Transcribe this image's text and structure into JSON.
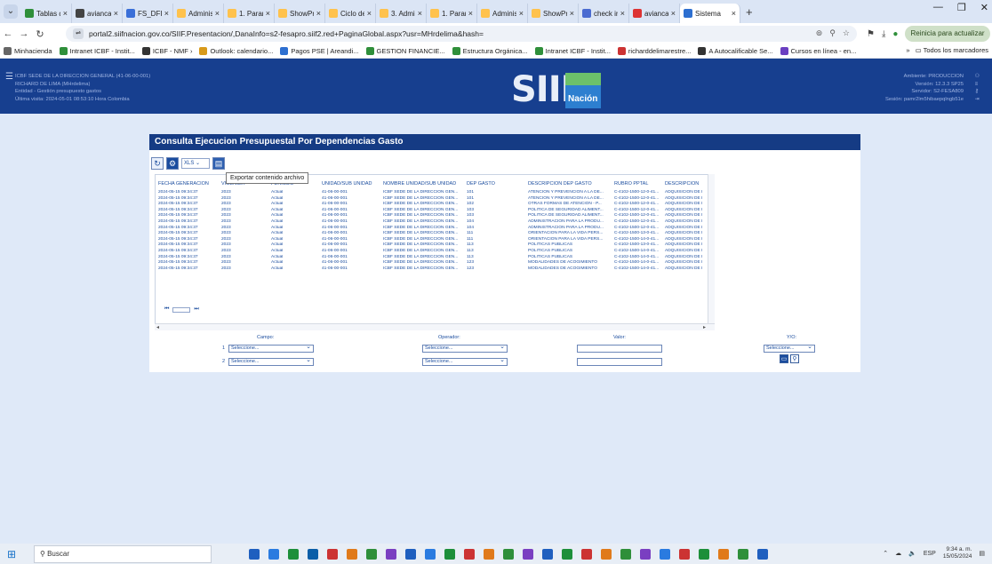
{
  "browser": {
    "tabs": [
      {
        "label": "Tablas de",
        "color": "#2f8f3a"
      },
      {
        "label": "avianca",
        "color": "#444"
      },
      {
        "label": "FS_DFIN",
        "color": "#3a6fd8"
      },
      {
        "label": "Administ",
        "color": "#ffc24d"
      },
      {
        "label": "1. Param",
        "color": "#ffc24d"
      },
      {
        "label": "ShowPro",
        "color": "#ffc24d"
      },
      {
        "label": "Ciclo de",
        "color": "#ffc24d"
      },
      {
        "label": "3. Admin",
        "color": "#ffc24d"
      },
      {
        "label": "1. Param",
        "color": "#ffc24d"
      },
      {
        "label": "Administ",
        "color": "#ffc24d"
      },
      {
        "label": "ShowPro",
        "color": "#ffc24d"
      },
      {
        "label": "check in",
        "color": "#4a6bd1"
      },
      {
        "label": "avianca",
        "color": "#d33"
      }
    ],
    "active_tab": {
      "label": "Sistema",
      "color": "#2d6fd0"
    },
    "url": "portal2.siifnacion.gov.co/SIIF.Presentacion/,DanaInfo=s2-fesapro.siif2.red+PaginaGlobal.aspx?usr=MHrdelima&hash=",
    "update_label": "Reinicia para actualizar",
    "bookmarks": [
      {
        "label": "Minhacienda",
        "color": "#666"
      },
      {
        "label": "Intranet ICBF - Instit...",
        "color": "#2f8f3a"
      },
      {
        "label": "ICBF - NMF ›",
        "color": "#333"
      },
      {
        "label": "Outlook: calendario...",
        "color": "#d89a1a"
      },
      {
        "label": "Pagos PSE | Areandi...",
        "color": "#2d6fd0"
      },
      {
        "label": "GESTION FINANCIE...",
        "color": "#2f8f3a"
      },
      {
        "label": "Estructura Orgánica...",
        "color": "#2f8f3a"
      },
      {
        "label": "Intranet ICBF - Instit...",
        "color": "#2f8f3a"
      },
      {
        "label": "richarddelimarestre...",
        "color": "#c33"
      },
      {
        "label": "A Autocalificable Se...",
        "color": "#333"
      },
      {
        "label": "Cursos en línea - en...",
        "color": "#6a3fc1"
      }
    ],
    "bookmarks_all": "Todos los marcadores"
  },
  "header": {
    "lines_left": [
      "ICBF SEDE DE LA DIRECCION GENERAL (41-06-00-001)",
      "RICHARD DE LIMA (MHrdelima)",
      "Entidad - Gestión presupuesto gastos",
      "Última visita: 2024-05-01 08:53:10 Hora Colombia"
    ],
    "logo_text": "SIIF",
    "logo_sub": "Nación",
    "lines_right": [
      "Ambiente: PRODUCCION",
      "Versión: 12.3.3 SP25",
      "Servidor: S2-FESA809",
      "Sesión: pamr2lm5hibaepqlngb51e"
    ]
  },
  "panel": {
    "title": "Consulta Ejecucion Presupuestal Por Dependencias Gasto",
    "format": "XLS",
    "tooltip": "Exportar contenido archivo",
    "columns": [
      "FECHA GENERACION",
      "VIGENCIA",
      "PERIODO",
      "UNIDAD/SUB UNIDAD",
      "NOMBRE UNIDAD/SUB UNIDAD",
      "DEP GASTO",
      "DESCRIPCION DEP GASTO",
      "RUBRO PPTAL",
      "DESCRIPCION"
    ],
    "rows": [
      [
        "2024-05-15 09:34:37",
        "2023",
        "Actual",
        "41-06-00-001",
        "ICBF SEDE DE LA DIRECCION GEN...",
        "101",
        "ATENCION Y PREVENCION A LA DE...",
        "C-4102-1500-12-0-41...",
        "ADQUISICIÓN DE I"
      ],
      [
        "2024-05-15 09:34:37",
        "2023",
        "Actual",
        "41-06-00-001",
        "ICBF SEDE DE LA DIRECCION GEN...",
        "101",
        "ATENCION Y PREVENCION A LA DE...",
        "C-4102-1500-12-0-41...",
        "ADQUISICIÓN DE I"
      ],
      [
        "2024-05-15 09:34:37",
        "2023",
        "Actual",
        "41-06-00-001",
        "ICBF SEDE DE LA DIRECCION GEN...",
        "102",
        "OTRAS FORMAS DE ATENCION - P...",
        "C-4102-1500-12-0-41...",
        "ADQUISICIÓN DE I"
      ],
      [
        "2024-05-15 09:34:37",
        "2023",
        "Actual",
        "41-06-00-001",
        "ICBF SEDE DE LA DIRECCION GEN...",
        "103",
        "POLITICA DE SEGURIDAD ALIMENT...",
        "C-4102-1500-12-0-41...",
        "ADQUISICIÓN DE I"
      ],
      [
        "2024-05-15 09:34:37",
        "2023",
        "Actual",
        "41-06-00-001",
        "ICBF SEDE DE LA DIRECCION GEN...",
        "103",
        "POLITICA DE SEGURIDAD ALIMENT...",
        "C-4102-1500-12-0-41...",
        "ADQUISICIÓN DE I"
      ],
      [
        "2024-05-15 09:34:37",
        "2023",
        "Actual",
        "41-06-00-001",
        "ICBF SEDE DE LA DIRECCION GEN...",
        "104",
        "ADMINISTRACION PARA LA PRODU...",
        "C-4102-1500-12-0-41...",
        "ADQUISICIÓN DE I"
      ],
      [
        "2024-05-15 09:34:37",
        "2023",
        "Actual",
        "41-06-00-001",
        "ICBF SEDE DE LA DIRECCION GEN...",
        "104",
        "ADMINISTRACION PARA LA PRODU...",
        "C-4102-1500-12-0-41...",
        "ADQUISICIÓN DE I"
      ],
      [
        "2024-05-15 09:34:37",
        "2023",
        "Actual",
        "41-06-00-001",
        "ICBF SEDE DE LA DIRECCION GEN...",
        "111",
        "ORIENTACION PARA LA VIDA PERS...",
        "C-4102-1500-13-0-41...",
        "ADQUISICIÓN DE I"
      ],
      [
        "2024-05-15 09:34:37",
        "2023",
        "Actual",
        "41-06-00-001",
        "ICBF SEDE DE LA DIRECCION GEN...",
        "111",
        "ORIENTACION PARA LA VIDA PERS...",
        "C-4102-1500-14-0-41...",
        "ADQUISICIÓN DE I"
      ],
      [
        "2024-05-15 09:34:37",
        "2023",
        "Actual",
        "41-06-00-001",
        "ICBF SEDE DE LA DIRECCION GEN...",
        "113",
        "POLITICAS PUBLICAS",
        "C-4102-1500-13-0-41...",
        "ADQUISICIÓN DE I"
      ],
      [
        "2024-05-15 09:34:37",
        "2023",
        "Actual",
        "41-06-00-001",
        "ICBF SEDE DE LA DIRECCION GEN...",
        "113",
        "POLITICAS PUBLICAS",
        "C-4102-1500-14-0-41...",
        "ADQUISICIÓN DE I"
      ],
      [
        "2024-05-15 09:34:37",
        "2023",
        "Actual",
        "41-06-00-001",
        "ICBF SEDE DE LA DIRECCION GEN...",
        "113",
        "POLITICAS PUBLICAS",
        "C-4102-1500-14-0-41...",
        "ADQUISICIÓN DE I"
      ],
      [
        "2024-05-15 09:34:37",
        "2023",
        "Actual",
        "41-06-00-001",
        "ICBF SEDE DE LA DIRECCION GEN...",
        "123",
        "MODALIDADES DE ACOGIMIENTO",
        "C-4102-1500-14-0-41...",
        "ADQUISICIÓN DE I"
      ],
      [
        "2024-05-15 09:34:37",
        "2023",
        "Actual",
        "41-06-00-001",
        "ICBF SEDE DE LA DIRECCION GEN...",
        "123",
        "MODALIDADES DE ACOGIMIENTO",
        "C-4102-1500-14-0-41...",
        "ADQUISICIÓN DE I"
      ]
    ],
    "filters": {
      "campo_label": "Campo:",
      "operador_label": "Operador:",
      "valor_label": "Valor:",
      "yo_label": "Y/O:",
      "row1_num": "1",
      "row2_num": "2",
      "select_text": "Seleccione..."
    }
  },
  "taskbar": {
    "search_placeholder": "Buscar",
    "lang": "ESP",
    "time": "9:34 a. m.",
    "date": "15/05/2024",
    "icons": [
      "#1f5fbf",
      "#2a7be0",
      "#1d8f3a",
      "#0b5ea8",
      "#c33",
      "#e07a1a",
      "#2f8f3a",
      "#7a3fc1",
      "#1f5fbf",
      "#2a7be0",
      "#1d8f3a",
      "#c33",
      "#e07a1a",
      "#2f8f3a",
      "#7a3fc1",
      "#1f5fbf",
      "#1d8f3a",
      "#c33",
      "#e07a1a",
      "#2f8f3a",
      "#7a3fc1",
      "#2a7be0",
      "#c33",
      "#1d8f3a",
      "#e07a1a",
      "#2f8f3a",
      "#1f5fbf"
    ]
  }
}
